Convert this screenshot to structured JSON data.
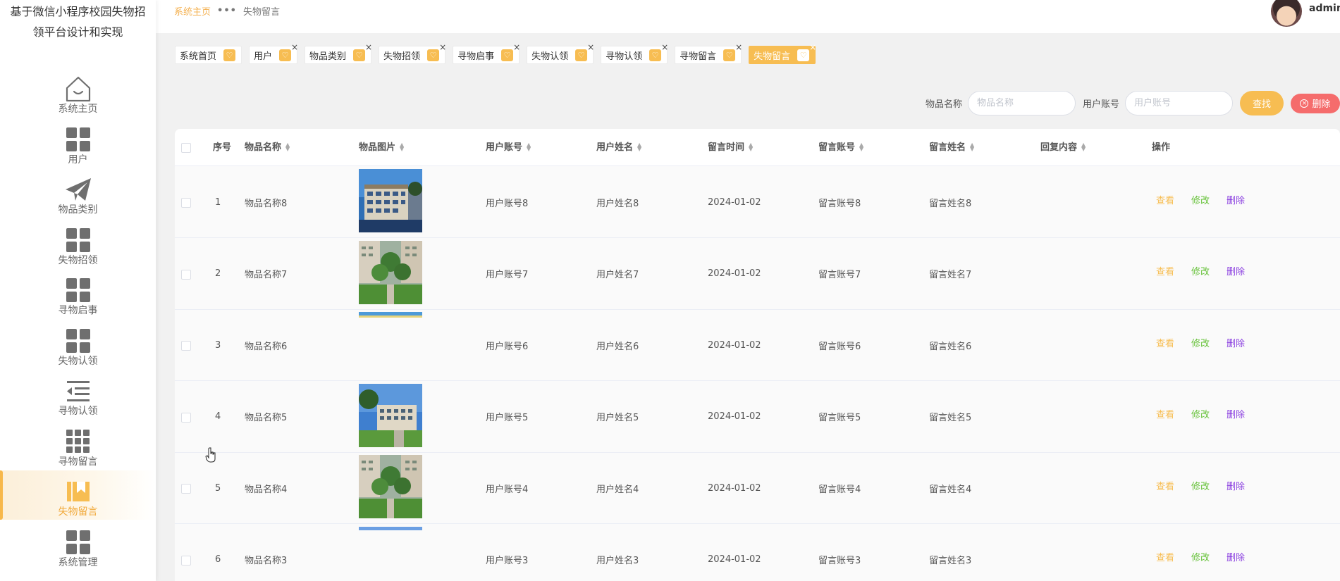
{
  "app": {
    "title": "基于微信小程序校园失物招领平台设计和实现"
  },
  "sidebar": {
    "items": [
      {
        "label": "系统主页",
        "icon": "home-icon",
        "active": false
      },
      {
        "label": "用户",
        "icon": "grid-icon",
        "active": false
      },
      {
        "label": "物品类别",
        "icon": "paper-plane-icon",
        "active": false
      },
      {
        "label": "失物招领",
        "icon": "grid-icon",
        "active": false
      },
      {
        "label": "寻物启事",
        "icon": "grid-icon",
        "active": false
      },
      {
        "label": "失物认领",
        "icon": "grid-icon",
        "active": false
      },
      {
        "label": "寻物认领",
        "icon": "list-indent-icon",
        "active": false
      },
      {
        "label": "寻物留言",
        "icon": "grid9-icon",
        "active": false
      },
      {
        "label": "失物留言",
        "icon": "bookmark-icon",
        "active": true
      },
      {
        "label": "系统管理",
        "icon": "grid-icon",
        "active": false
      }
    ]
  },
  "header": {
    "breadcrumb_home": "系统主页",
    "breadcrumb_sep": "•••",
    "breadcrumb_current": "失物留言",
    "username": "admin"
  },
  "tags": [
    {
      "label": "系统首页",
      "closable": false,
      "active": false
    },
    {
      "label": "用户",
      "closable": true,
      "active": false
    },
    {
      "label": "物品类别",
      "closable": true,
      "active": false
    },
    {
      "label": "失物招领",
      "closable": true,
      "active": false
    },
    {
      "label": "寻物启事",
      "closable": true,
      "active": false
    },
    {
      "label": "失物认领",
      "closable": true,
      "active": false
    },
    {
      "label": "寻物认领",
      "closable": true,
      "active": false
    },
    {
      "label": "寻物留言",
      "closable": true,
      "active": false
    },
    {
      "label": "失物留言",
      "closable": true,
      "active": true
    }
  ],
  "search": {
    "item_name_label": "物品名称",
    "item_name_placeholder": "物品名称",
    "user_account_label": "用户账号",
    "user_account_placeholder": "用户账号",
    "find_label": "查找",
    "delete_label": "删除"
  },
  "table": {
    "columns": [
      "序号",
      "物品名称",
      "物品图片",
      "用户账号",
      "用户姓名",
      "留言时间",
      "留言账号",
      "留言姓名",
      "回复内容",
      "操作"
    ],
    "actions": {
      "view": "查看",
      "edit": "修改",
      "delete": "删除"
    },
    "rows": [
      {
        "index": "1",
        "item_name": "物品名称8",
        "image": "campus-building",
        "user_account": "用户账号8",
        "user_name": "用户姓名8",
        "time": "2024-01-02",
        "msg_account": "留言账号8",
        "msg_name": "留言姓名8",
        "reply": ""
      },
      {
        "index": "2",
        "item_name": "物品名称7",
        "image": "campus-garden",
        "user_account": "用户账号7",
        "user_name": "用户姓名7",
        "time": "2024-01-02",
        "msg_account": "留言账号7",
        "msg_name": "留言姓名7",
        "reply": ""
      },
      {
        "index": "3",
        "item_name": "物品名称6",
        "image": "broken",
        "user_account": "用户账号6",
        "user_name": "用户姓名6",
        "time": "2024-01-02",
        "msg_account": "留言账号6",
        "msg_name": "留言姓名6",
        "reply": ""
      },
      {
        "index": "4",
        "item_name": "物品名称5",
        "image": "campus-sky",
        "user_account": "用户账号5",
        "user_name": "用户姓名5",
        "time": "2024-01-02",
        "msg_account": "留言账号5",
        "msg_name": "留言姓名5",
        "reply": ""
      },
      {
        "index": "5",
        "item_name": "物品名称4",
        "image": "campus-garden",
        "user_account": "用户账号4",
        "user_name": "用户姓名4",
        "time": "2024-01-02",
        "msg_account": "留言账号4",
        "msg_name": "留言姓名4",
        "reply": ""
      },
      {
        "index": "6",
        "item_name": "物品名称3",
        "image": "broken-blue",
        "user_account": "用户账号3",
        "user_name": "用户姓名3",
        "time": "2024-01-02",
        "msg_account": "留言账号3",
        "msg_name": "留言姓名3",
        "reply": ""
      }
    ]
  },
  "colors": {
    "accent": "#f7bd52",
    "danger": "#f56c6c",
    "edit": "#67c23a",
    "delete_link": "#8a3ee0"
  }
}
